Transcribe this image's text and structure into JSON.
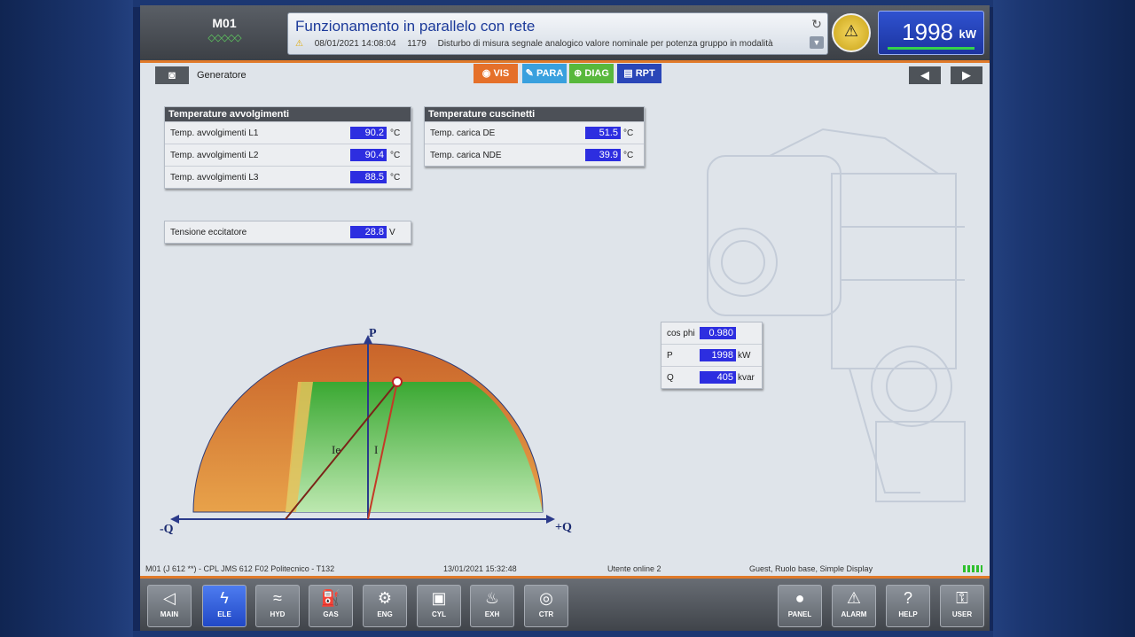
{
  "header": {
    "unit_name": "M01",
    "unit_dots": "◇◇◇◇◇",
    "message_title": "Funzionamento in parallelo con rete",
    "message_date": "08/01/2021 14:08:04",
    "message_code": "1179",
    "message_text": "Disturbo di misura segnale analogico valore nominale per potenza gruppo in modalità",
    "power_value": "1998",
    "power_unit": "kW"
  },
  "toolbar": {
    "section": "Generatore",
    "tabs": [
      {
        "label": "VIS",
        "color": "#e5702a"
      },
      {
        "label": "PARA",
        "color": "#39a0de"
      },
      {
        "label": "DIAG",
        "color": "#58b83c"
      },
      {
        "label": "RPT",
        "color": "#2a46b8"
      }
    ]
  },
  "windings": {
    "title": "Temperature avvolgimenti",
    "rows": [
      {
        "label": "Temp. avvolgimenti L1",
        "value": "90.2",
        "unit": "°C"
      },
      {
        "label": "Temp. avvolgimenti L2",
        "value": "90.4",
        "unit": "°C"
      },
      {
        "label": "Temp. avvolgimenti L3",
        "value": "88.5",
        "unit": "°C"
      }
    ]
  },
  "bearings": {
    "title": "Temperature cuscinetti",
    "rows": [
      {
        "label": "Temp. carica DE",
        "value": "51.5",
        "unit": "°C"
      },
      {
        "label": "Temp. carica NDE",
        "value": "39.9",
        "unit": "°C"
      }
    ]
  },
  "exciter": {
    "label": "Tensione eccitatore",
    "value": "28.8",
    "unit": "V"
  },
  "power_values": [
    {
      "label": "cos phi",
      "value": "0.980",
      "unit": ""
    },
    {
      "label": "P",
      "value": "1998",
      "unit": "kW"
    },
    {
      "label": "Q",
      "value": "405",
      "unit": "kvar"
    }
  ],
  "diagram": {
    "p_axis": "P",
    "neg_q_axis": "-Q",
    "pos_q_axis": "+Q",
    "ie_label": "Ie",
    "i_label": "I",
    "colors": {
      "outer": "#d9772e",
      "inner": "#4cb840",
      "vector_ie": "#7a2418",
      "vector_i": "#c43a26"
    }
  },
  "status": {
    "station": "M01 (J 612 **) - CPL JMS 612 F02 Politecnico - T132",
    "datetime": "13/01/2021 15:32:48",
    "online": "Utente online 2",
    "user": "Guest, Ruolo base, Simple Display"
  },
  "nav_buttons": [
    {
      "label": "MAIN",
      "icon": "◁"
    },
    {
      "label": "ELE",
      "icon": "ϟ"
    },
    {
      "label": "HYD",
      "icon": "≈"
    },
    {
      "label": "GAS",
      "icon": "⛽"
    },
    {
      "label": "ENG",
      "icon": "⚙"
    },
    {
      "label": "CYL",
      "icon": "▣"
    },
    {
      "label": "EXH",
      "icon": "♨"
    },
    {
      "label": "CTR",
      "icon": "◎"
    },
    {
      "label": "PANEL",
      "icon": "●"
    },
    {
      "label": "ALARM",
      "icon": "⚠"
    },
    {
      "label": "HELP",
      "icon": "?"
    },
    {
      "label": "USER",
      "icon": "⚿"
    }
  ]
}
